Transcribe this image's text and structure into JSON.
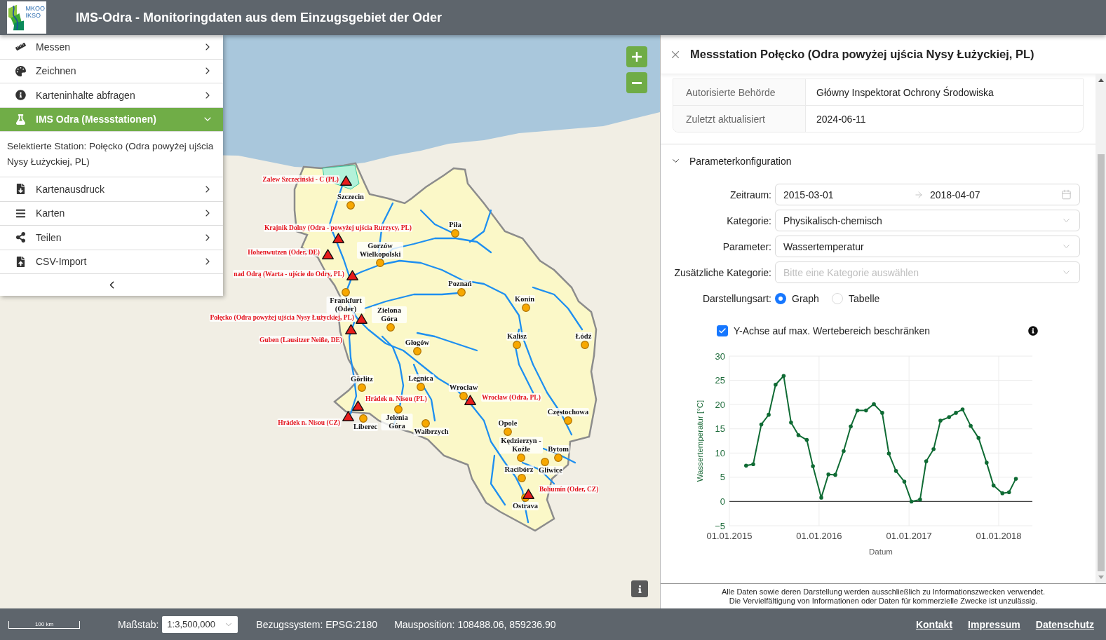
{
  "header": {
    "logo_lines": [
      "MKOO",
      "IKSO"
    ],
    "title": "IMS-Odra - Monitoringdaten aus dem Einzugsgebiet der Oder"
  },
  "sidebar": {
    "items": [
      {
        "label": "Messen",
        "expanded": false
      },
      {
        "label": "Zeichnen",
        "expanded": false
      },
      {
        "label": "Karteninhalte abfragen",
        "expanded": false
      },
      {
        "label": "IMS Odra (Messstationen)",
        "expanded": true,
        "content": "Selektierte Station: Połęcko (Odra powyżej ujścia Nysy Łużyckiej, PL)"
      },
      {
        "label": "Kartenausdruck",
        "expanded": false
      },
      {
        "label": "Karten",
        "expanded": false
      },
      {
        "label": "Teilen",
        "expanded": false
      },
      {
        "label": "CSV-Import",
        "expanded": false
      }
    ]
  },
  "map": {
    "stations": [
      {
        "label": "Zalew Szczeciński - C (PL)"
      },
      {
        "label": "Krajnik Dolny (Odra - powyżej ujścia Rurzycy, PL)"
      },
      {
        "label": "Hohenwutzen (Oder, DE)"
      },
      {
        "label": "nad Odrą (Warta - ujście do Odry, PL)"
      },
      {
        "label": "Połęcko (Odra powyżej ujścia Nysy Łużyckiej, PL)"
      },
      {
        "label": "Guben (Lausitzer Neiße, DE)"
      },
      {
        "label": "Hrádek n. Nisou (PL)"
      },
      {
        "label": "Wrocław (Odra, PL)"
      },
      {
        "label": "Hrádek n. Nisou (CZ)"
      },
      {
        "label": "Bohumín (Oder, CZ)"
      }
    ],
    "cities": [
      {
        "label": "Szczecin"
      },
      {
        "label": "Piła"
      },
      {
        "label": "Gorzów Wielkopolski"
      },
      {
        "label": "Poznań"
      },
      {
        "label": "Frankfurt (Oder)"
      },
      {
        "label": "Zielona Góra"
      },
      {
        "label": "Konin"
      },
      {
        "label": "Kalisz"
      },
      {
        "label": "Łódź"
      },
      {
        "label": "Głogów"
      },
      {
        "label": "Legnica"
      },
      {
        "label": "Görlitz"
      },
      {
        "label": "Wrocław"
      },
      {
        "label": "Liberec"
      },
      {
        "label": "Jelenia Góra"
      },
      {
        "label": "Wałbrzych"
      },
      {
        "label": "Częstochowa"
      },
      {
        "label": "Opole"
      },
      {
        "label": "Kędzierzyn - Koźle"
      },
      {
        "label": "Gliwice"
      },
      {
        "label": "Bytom"
      },
      {
        "label": "Racibórz"
      },
      {
        "label": "Ostrava"
      }
    ]
  },
  "panel": {
    "title": "Messstation Połęcko (Odra powyżej ujścia Nysy Łużyckiej, PL)",
    "info_rows": [
      {
        "label": "Autorisierte Behörde",
        "value": "Główny Inspektorat Ochrony Środowiska"
      },
      {
        "label": "Zuletzt aktualisiert",
        "value": "2024-06-11"
      }
    ],
    "section": {
      "title": "Parameterkonfiguration",
      "expanded": true
    },
    "form": {
      "fields": [
        {
          "kind": "date_range",
          "label": "Zeitraum:",
          "start": "2015-03-01",
          "end": "2018-04-07"
        },
        {
          "kind": "select",
          "label": "Kategorie:",
          "value": "Physikalisch-chemisch"
        },
        {
          "kind": "select",
          "label": "Parameter:",
          "value": "Wassertemperatur"
        },
        {
          "kind": "select",
          "label": "Zusätzliche Kategorie:",
          "placeholder": "Bitte eine Kategorie auswählen"
        },
        {
          "kind": "radio",
          "label": "Darstellungsart:",
          "options": [
            {
              "label": "Graph",
              "selected": true
            },
            {
              "label": "Tabelle",
              "selected": false
            }
          ]
        }
      ]
    },
    "y_axis_checkbox": {
      "label": "Y-Achse auf max. Wertebereich beschränken",
      "checked": true
    },
    "chart_data": {
      "type": "line",
      "xlabel": "Datum",
      "ylabel": "Wassertemperatur [°C]",
      "x": [
        "2015-03-10",
        "2015-04-08",
        "2015-05-11",
        "2015-06-10",
        "2015-07-08",
        "2015-08-10",
        "2015-09-09",
        "2015-10-09",
        "2015-11-12",
        "2015-12-07",
        "2016-01-10",
        "2016-02-08",
        "2016-03-07",
        "2016-04-10",
        "2016-05-09",
        "2016-06-05",
        "2016-07-10",
        "2016-08-11",
        "2016-09-14",
        "2016-10-11",
        "2016-11-09",
        "2016-12-13",
        "2017-01-11",
        "2017-02-15",
        "2017-03-12",
        "2017-04-11",
        "2017-05-09",
        "2017-06-13",
        "2017-07-11",
        "2017-08-07",
        "2017-09-09",
        "2017-10-11",
        "2017-11-13",
        "2017-12-11",
        "2018-01-16",
        "2018-02-12",
        "2018-03-12"
      ],
      "series": [
        {
          "color": "#0f6b34",
          "values": [
            7.4,
            7.7,
            15.9,
            17.9,
            24.1,
            25.9,
            16.3,
            13.7,
            12.7,
            7.3,
            0.8,
            5.6,
            5.5,
            10.4,
            15.5,
            18.8,
            18.8,
            20.1,
            18.3,
            9.9,
            6.3,
            4.1,
            0,
            0.4,
            8.3,
            10.8,
            16.7,
            17.4,
            18.3,
            19.0,
            15.6,
            13.1,
            8.0,
            3.3,
            1.7,
            1.9,
            4.7
          ]
        }
      ],
      "xlim": [
        "2015-01-01",
        "2018-05-18"
      ],
      "ylim": [
        -5,
        30
      ],
      "xticks": [
        {
          "value": "2015-01-01",
          "label": "01.01.2015"
        },
        {
          "value": "2016-01-01",
          "label": "01.01.2016"
        },
        {
          "value": "2017-01-01",
          "label": "01.01.2017"
        },
        {
          "value": "2018-01-01",
          "label": "01.01.2018"
        }
      ],
      "yticks": [
        {
          "value": -5,
          "label": "−5"
        },
        0,
        5,
        10,
        15,
        20,
        25,
        30
      ],
      "grid": true
    },
    "disclaimer": [
      "Alle Daten sowie deren Darstellung werden ausschließlich zu Informationszwecken verwendet.",
      "Die Vervielfältigung von Informationen oder Daten für kommerzielle Zwecke ist unzulässig."
    ]
  },
  "status_bar": {
    "scale_label": "100 km",
    "scale_field": {
      "label": "Maßstab:",
      "value": "1:3,500,000"
    },
    "crs": "Bezugssystem: EPSG:2180",
    "mouse_position": "Mausposition: 108488.06, 859236.90",
    "links": [
      "Kontakt",
      "Impressum",
      "Datenschutz"
    ]
  }
}
